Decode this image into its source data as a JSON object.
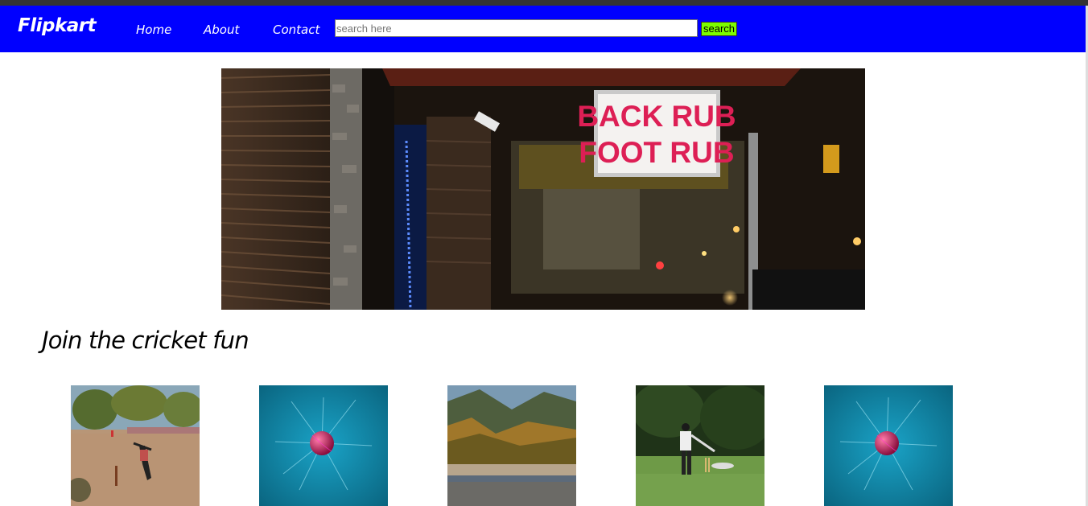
{
  "navbar": {
    "logo": "Flipkart",
    "links": [
      "Home",
      "About",
      "Contact"
    ],
    "search_placeholder": "search here",
    "search_button": "search",
    "bg_color": "#0000ff",
    "button_color": "#7cfc00"
  },
  "hero": {
    "sign_line1": "BACK RUB",
    "sign_line2": "FOOT RUB"
  },
  "section": {
    "title": "Join the cricket fun"
  },
  "gallery": {
    "images": [
      "cricket-field-photo",
      "cricket-ball-splash-photo",
      "lake-forest-photo",
      "batsman-photo",
      "cricket-ball-splash-photo"
    ]
  }
}
